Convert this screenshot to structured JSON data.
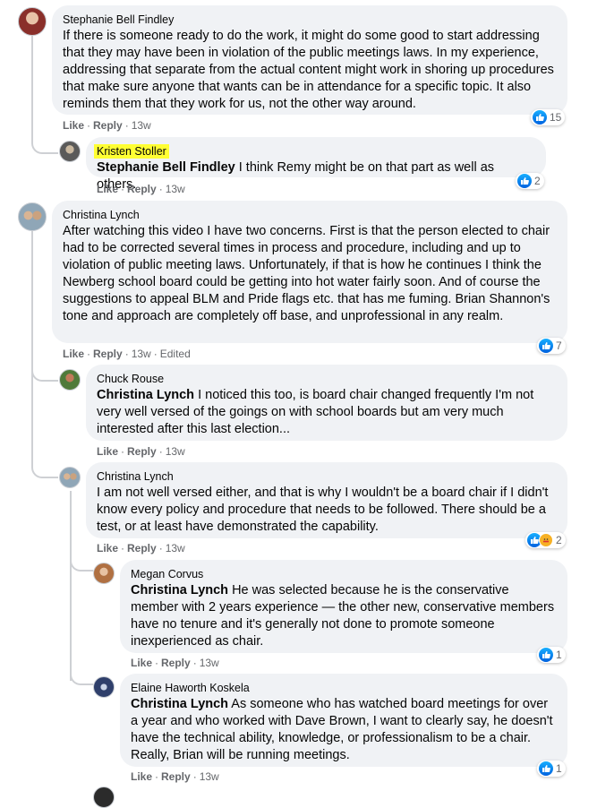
{
  "comments": [
    {
      "author": "Stephanie Bell Findley",
      "mention": "",
      "text": "If there is someone ready to do the work, it might do some good to start addressing that they may have been in violation of the public meetings laws. In my experience, addressing that separate from the actual content might work in shoring up procedures that make sure anyone that wants can be in attendance for a specific topic. It also reminds them that they work for us, not the other way around.",
      "like_label": "Like",
      "reply_label": "Reply",
      "time": "13w",
      "edited": "",
      "reaction_count": "15"
    },
    {
      "author": "Kristen Stoller",
      "mention": "Stephanie Bell Findley",
      "text": "I think Remy might be on that part as well as others.",
      "like_label": "Like",
      "reply_label": "Reply",
      "time": "13w",
      "edited": "",
      "reaction_count": "2"
    },
    {
      "author": "Christina Lynch",
      "mention": "",
      "text": "After watching this video I have two concerns. First is that the person elected to chair had to be corrected several times in process and procedure, including and up to violation of public meeting laws. Unfortunately, if that is how he continues I think the Newberg school board could be getting into hot water fairly soon. And of course the suggestions to appeal BLM and Pride flags etc. that has me fuming. Brian Shannon's tone and approach are completely off base, and unprofessional in any realm.",
      "like_label": "Like",
      "reply_label": "Reply",
      "time": "13w",
      "edited": "Edited",
      "reaction_count": "7"
    },
    {
      "author": "Chuck Rouse",
      "mention": "Christina Lynch",
      "text": "I noticed this too, is board chair changed frequently I'm not very well versed of the goings on with school boards but am very much interested after this last election...",
      "like_label": "Like",
      "reply_label": "Reply",
      "time": "13w",
      "edited": "",
      "reaction_count": ""
    },
    {
      "author": "Christina Lynch",
      "mention": "",
      "text": "I am not well versed either, and that is why I wouldn't be a board chair if I didn't know every policy and procedure that needs to be followed. There should be a test, or at least have demonstrated the capability.",
      "like_label": "Like",
      "reply_label": "Reply",
      "time": "13w",
      "edited": "",
      "reaction_count": "2"
    },
    {
      "author": "Megan Corvus",
      "mention": "Christina Lynch",
      "text": "He was selected because he is the conservative member with 2 years experience — the other new, conservative members have no tenure and it's generally not done to promote someone inexperienced as chair.",
      "like_label": "Like",
      "reply_label": "Reply",
      "time": "13w",
      "edited": "",
      "reaction_count": "1"
    },
    {
      "author": "Elaine Haworth Koskela",
      "mention": "Christina Lynch",
      "text": "As someone who has watched board meetings for over a year and who worked with Dave Brown, I want to clearly say, he doesn't have the technical ability, knowledge, or professionalism to be a chair. Really, Brian will be running meetings.",
      "like_label": "Like",
      "reply_label": "Reply",
      "time": "13w",
      "edited": "",
      "reaction_count": "1"
    }
  ],
  "colors": {
    "bubble": "#f0f2f5",
    "meta": "#65676b",
    "like_blue": "#1877f2",
    "highlight": "#ffff33"
  }
}
